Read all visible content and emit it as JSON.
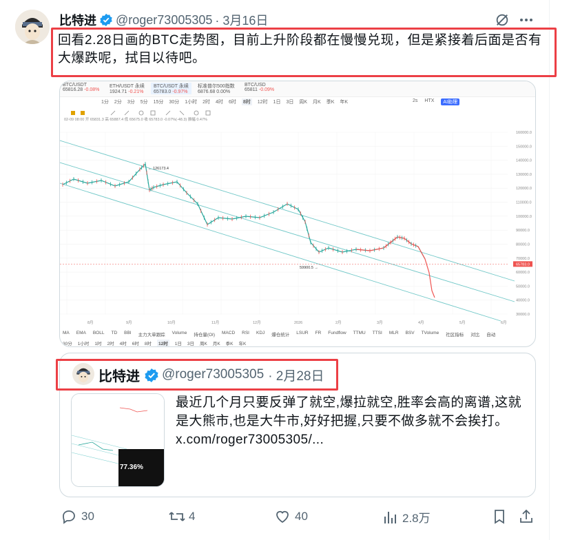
{
  "tweet": {
    "author_name": "比特进",
    "handle": "@roger73005305",
    "date": "· 3月16日",
    "text": "回看2.28日画的BTC走势图，目前上升阶段都在慢慢兑现，但是紧接着后面是否有大爆跌呢，拭目以待吧。"
  },
  "chart_app": {
    "tickers": [
      {
        "name": "BTC/USDT",
        "price": "65816.28",
        "change": "-0.08%"
      },
      {
        "name": "ETH/USDT 永续",
        "price": "1924.71",
        "change": "-0.21%"
      },
      {
        "name": "BTC/USDT 永续",
        "price": "65783.0",
        "change": "-0.97%"
      },
      {
        "name": "标准普尔500指数",
        "price": "6876.68",
        "change": "0.00%"
      },
      {
        "name": "BTC/USD",
        "price": "65811",
        "change": "-0.09%"
      }
    ],
    "timeframes_top": [
      "1分",
      "2分",
      "3分",
      "5分",
      "15分",
      "30分",
      "1小时",
      "2时",
      "4时",
      "6时",
      "8时",
      "12时",
      "1日",
      "3日",
      "周K",
      "月K",
      "季K",
      "年K"
    ],
    "toolbar_right": [
      "2s",
      "HTX",
      "AI助理"
    ],
    "ohlc_line": "02-09 08:00  开 65831.3  高 65887.4  低 65675.0  收 65783.0  -0.07%(-48.3)  振幅 0.47%",
    "price_axis": [
      "160000.0",
      "150000.0",
      "140000.0",
      "130000.0",
      "120000.0",
      "110000.0",
      "100000.0",
      "90000.0",
      "80000.0",
      "70000.0",
      "65783.0",
      "60000.0",
      "50000.0",
      "40000.0",
      "30000.0"
    ],
    "time_axis": [
      "8月",
      "9月",
      "10月",
      "11月",
      "12月",
      "2026",
      "2月",
      "3月",
      "4月",
      "5月",
      "6月"
    ],
    "annotations": {
      "high": "126173.4",
      "low": "59900.5"
    },
    "indicators": [
      "MA",
      "EMA",
      "BOLL",
      "TD",
      "BBI",
      "主力大单跟踪",
      "Volume",
      "持仓量(OI)",
      "MACD",
      "RSI",
      "KDJ",
      "爆仓统计",
      "LSUR",
      "FR",
      "Fundflow",
      "TTMU",
      "TTSI",
      "MLR",
      "BSV",
      "TVolume",
      "社区指标",
      "对比",
      "自动"
    ],
    "timeframes_bottom": [
      "30分",
      "1小时",
      "1时",
      "2时",
      "4时",
      "6时",
      "8时",
      "12时",
      "1日",
      "3日",
      "周K",
      "月K",
      "季K",
      "年K"
    ],
    "current_price_label": "65783.0"
  },
  "quote": {
    "author_name": "比特进",
    "handle": "@roger73005305",
    "date": "· 2月28日",
    "text": "最近几个月只要反弹了就空,爆拉就空,胜率会高的离谱,这就是大熊市,也是大牛市,好好把握,只要不做多就不会挨打。x.com/roger73005305/...",
    "thumb_percent": "77.36%"
  },
  "actions": {
    "replies": "30",
    "retweets": "4",
    "likes": "40",
    "views": "2.8万"
  },
  "colors": {
    "highlight": "#ec3f45",
    "verified": "#1d9bf0",
    "up": "#26a69a",
    "down": "#ef5350",
    "channel": "#6fc7c7"
  }
}
